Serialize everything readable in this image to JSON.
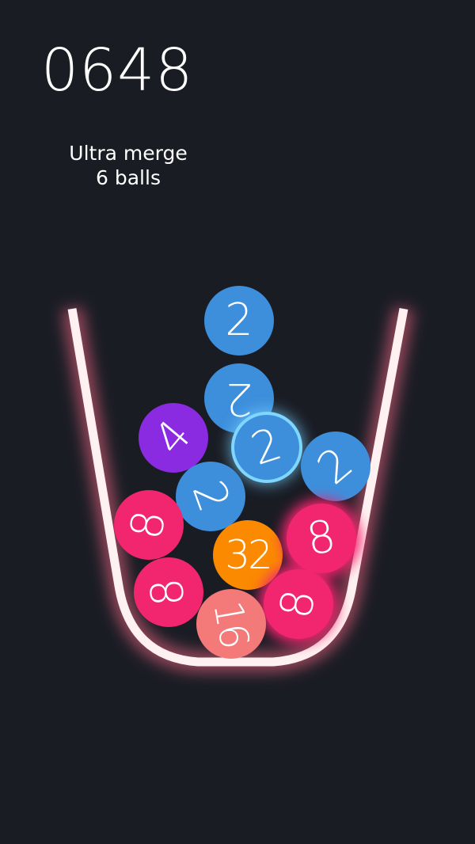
{
  "score": "0648",
  "combo": {
    "line1": "Ultra merge",
    "line2": "6 balls"
  },
  "colors": {
    "background": "#1a1c24",
    "cup": "#fff1f1",
    "ball_2": "#3d8fdc",
    "ball_4": "#8a2be2",
    "ball_8": "#f2266f",
    "ball_16": "#f47a7a",
    "ball_32": "#fb8a00"
  },
  "balls": [
    {
      "value": "2"
    },
    {
      "value": "2"
    },
    {
      "value": "4"
    },
    {
      "value": "2"
    },
    {
      "value": "2"
    },
    {
      "value": "2"
    },
    {
      "value": "8"
    },
    {
      "value": "32"
    },
    {
      "value": "8"
    },
    {
      "value": "8"
    },
    {
      "value": "8"
    },
    {
      "value": "16"
    }
  ]
}
